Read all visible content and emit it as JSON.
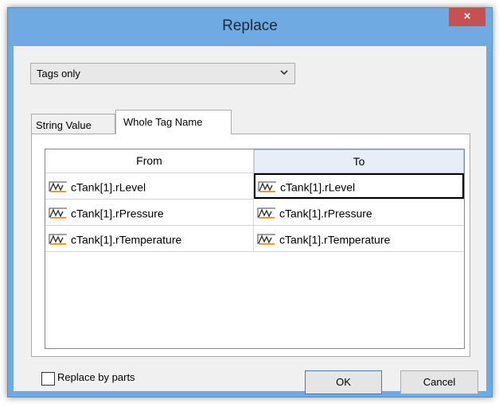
{
  "window": {
    "title": "Replace",
    "close_glyph": "×"
  },
  "scope_select": {
    "value": "Tags only",
    "options": [
      "Tags only"
    ]
  },
  "tabs": [
    {
      "label": "String Value",
      "active": false
    },
    {
      "label": "Whole Tag Name",
      "active": true
    }
  ],
  "grid": {
    "columns": [
      "From",
      "To"
    ],
    "rows": [
      {
        "from": "cTank[1].rLevel",
        "to": "cTank[1].rLevel",
        "selected_to": true
      },
      {
        "from": "cTank[1].rPressure",
        "to": "cTank[1].rPressure",
        "selected_to": false
      },
      {
        "from": "cTank[1].rTemperature",
        "to": "cTank[1].rTemperature",
        "selected_to": false
      }
    ],
    "row_icon": "analog-tag-icon"
  },
  "options": {
    "replace_by_parts_label": "Replace by parts",
    "replace_by_parts_checked": false
  },
  "buttons": {
    "ok": "OK",
    "cancel": "Cancel"
  },
  "colors": {
    "title_bar": "#6faae3",
    "close_button": "#c75050",
    "dialog_bg": "#f0f0f0"
  }
}
